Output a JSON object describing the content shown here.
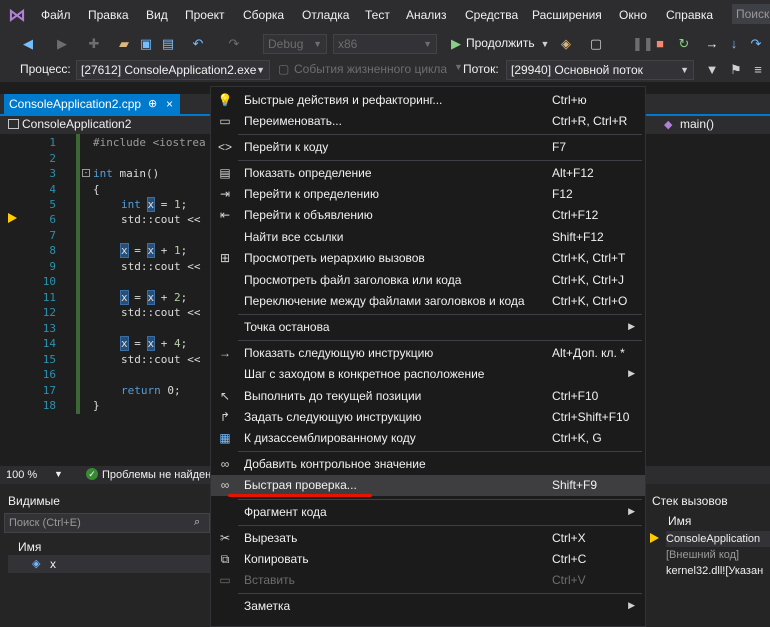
{
  "menubar": {
    "items": [
      "Файл",
      "Правка",
      "Вид",
      "Проект",
      "Сборка",
      "Отладка",
      "Тест",
      "Анализ",
      "Средства",
      "Расширения",
      "Окно",
      "Справка"
    ],
    "search_placeholder": "Поиск"
  },
  "toolbar": {
    "config": "Debug",
    "platform": "x86",
    "continue_label": "Продолжить"
  },
  "process_bar": {
    "process_label": "Процесс:",
    "process_value": "[27612] ConsoleApplication2.exe",
    "lifecycle_label": "События жизненного цикла",
    "thread_label": "Поток:",
    "thread_value": "[29940] Основной поток"
  },
  "tabs": {
    "active": "ConsoleApplication2.cpp",
    "pin": "⊕",
    "close": "×"
  },
  "navbar": {
    "project": "ConsoleApplication2",
    "member": "main()"
  },
  "editor": {
    "line_numbers": [
      "1",
      "2",
      "3",
      "4",
      "5",
      "6",
      "7",
      "8",
      "9",
      "10",
      "11",
      "12",
      "13",
      "14",
      "15",
      "16",
      "17",
      "18"
    ],
    "current_line": 6,
    "lines": {
      "l1": "#include <iostrea",
      "l3_kw": "int",
      "l3_rest": " main()",
      "l4": "{",
      "l5_kw": "int",
      "l5_var": "x",
      "l5_rest": " = ",
      "l5_num": "1",
      "l5_end": ";",
      "l6": "std::cout << ",
      "l8_var1": "x",
      "l8_mid": " = ",
      "l8_var2": "x",
      "l8_rest": " + ",
      "l8_num": "1",
      "l8_end": ";",
      "l9": "std::cout << ",
      "l11_var1": "x",
      "l11_mid": " = ",
      "l11_var2": "x",
      "l11_rest": " + ",
      "l11_num": "2",
      "l11_end": ";",
      "l12": "std::cout << ",
      "l14_var1": "x",
      "l14_mid": " = ",
      "l14_var2": "x",
      "l14_rest": " + ",
      "l14_num": "4",
      "l14_end": ";",
      "l15": "std::cout << ",
      "l17_kw": "return",
      "l17_rest": " 0;",
      "l18": "}"
    }
  },
  "editor_status": {
    "zoom": "100 %",
    "problems": "Проблемы не найден"
  },
  "locals": {
    "title": "Видимые",
    "search_placeholder": "Поиск (Ctrl+E)",
    "column_name": "Имя",
    "var_name": "x"
  },
  "call_stack": {
    "title": "Стек вызовов",
    "column_name": "Имя",
    "rows": [
      "ConsoleApplication",
      "[Внешний код]",
      "kernel32.dll![Указан"
    ]
  },
  "context_menu": {
    "items": [
      {
        "label": "Быстрые действия и рефакторинг...",
        "key": "Ctrl+ю"
      },
      {
        "label": "Переименовать...",
        "key": "Ctrl+R, Ctrl+R"
      },
      {
        "label": "Перейти к коду",
        "key": "F7"
      },
      {
        "label": "Показать определение",
        "key": "Alt+F12"
      },
      {
        "label": "Перейти к определению",
        "key": "F12"
      },
      {
        "label": "Перейти к объявлению",
        "key": "Ctrl+F12"
      },
      {
        "label": "Найти все ссылки",
        "key": "Shift+F12"
      },
      {
        "label": "Просмотреть иерархию вызовов",
        "key": "Ctrl+K, Ctrl+T"
      },
      {
        "label": "Просмотреть файл заголовка или кода",
        "key": "Ctrl+K, Ctrl+J"
      },
      {
        "label": "Переключение между файлами заголовков и кода",
        "key": "Ctrl+K, Ctrl+O"
      },
      {
        "label": "Точка останова",
        "key": ""
      },
      {
        "label": "Показать следующую инструкцию",
        "key": "Alt+Доп. кл. *"
      },
      {
        "label": "Шаг с заходом в конкретное расположение",
        "key": ""
      },
      {
        "label": "Выполнить до текущей позиции",
        "key": "Ctrl+F10"
      },
      {
        "label": "Задать следующую инструкцию",
        "key": "Ctrl+Shift+F10"
      },
      {
        "label": "К дизассемблированному коду",
        "key": "Ctrl+K, G"
      },
      {
        "label": "Добавить контрольное значение",
        "key": ""
      },
      {
        "label": "Быстрая проверка...",
        "key": "Shift+F9"
      },
      {
        "label": "Фрагмент кода",
        "key": ""
      },
      {
        "label": "Вырезать",
        "key": "Ctrl+X"
      },
      {
        "label": "Копировать",
        "key": "Ctrl+C"
      },
      {
        "label": "Вставить",
        "key": "Ctrl+V"
      },
      {
        "label": "Заметка",
        "key": ""
      }
    ],
    "highlighted_index": 17,
    "accent_underline_color": "#e51400"
  }
}
